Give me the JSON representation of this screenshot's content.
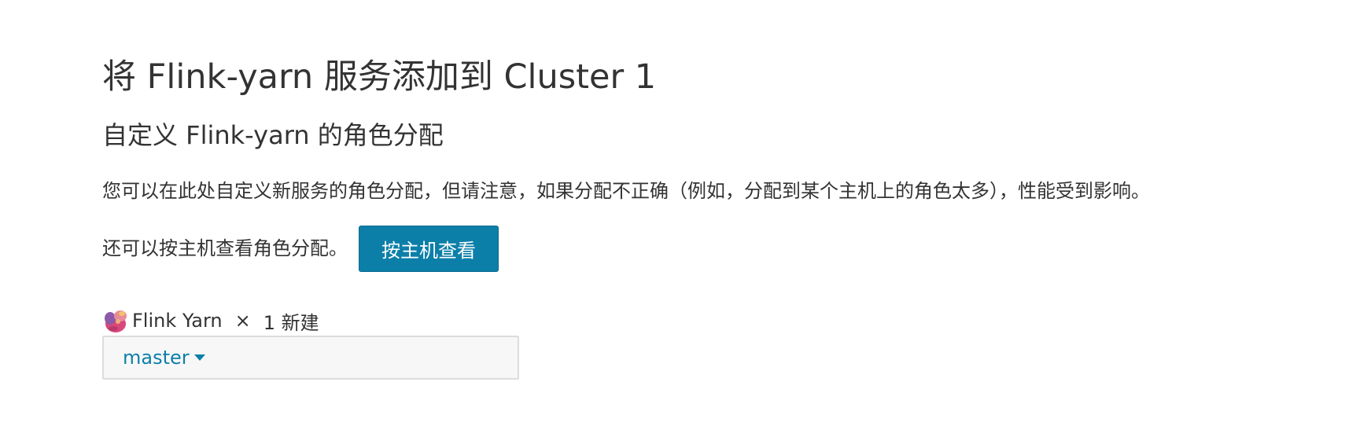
{
  "header": {
    "title": "将 Flink-yarn 服务添加到 Cluster 1",
    "subtitle": "自定义 Flink-yarn 的角色分配"
  },
  "main": {
    "description": "您可以在此处自定义新服务的角色分配，但请注意，如果分配不正确（例如，分配到某个主机上的角色太多），性能受到影响。",
    "view_by_host_text": "还可以按主机查看角色分配。",
    "view_by_host_button": "按主机查看"
  },
  "role": {
    "icon": "squirrel-mascot-icon",
    "name": "Flink Yarn",
    "times": "×",
    "count_label": "1 新建",
    "assignment_value": "master"
  },
  "colors": {
    "accent": "#0c7fa9",
    "box_background": "#f7f7f7",
    "border": "#dddddd"
  }
}
